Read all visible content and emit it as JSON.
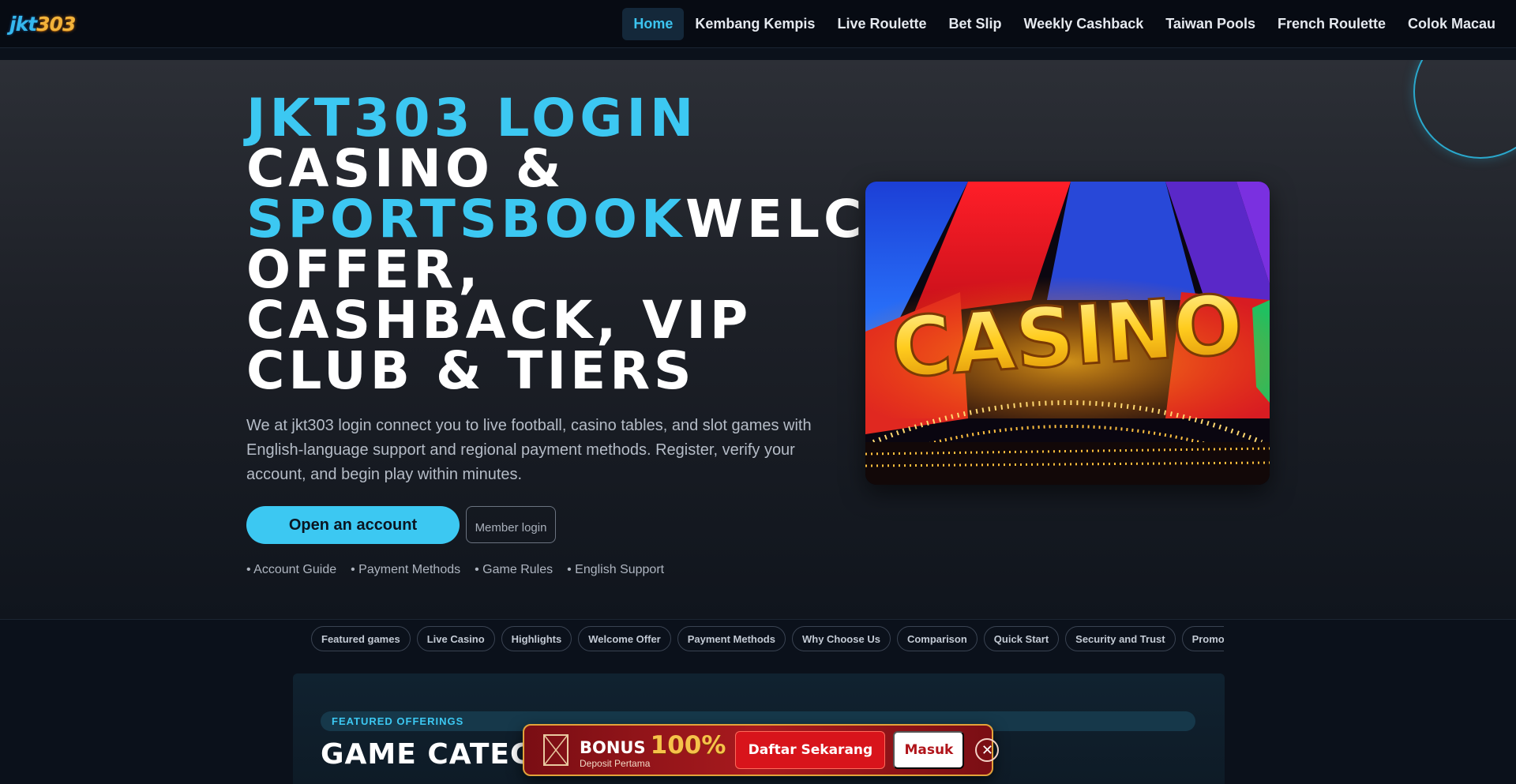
{
  "brand": {
    "logo_part1": "jkt",
    "logo_part2": "303"
  },
  "nav": {
    "items": [
      {
        "label": "Home",
        "active": true
      },
      {
        "label": "Kembang Kempis"
      },
      {
        "label": "Live Roulette"
      },
      {
        "label": "Bet Slip"
      },
      {
        "label": "Weekly Cashback"
      },
      {
        "label": "Taiwan Pools"
      },
      {
        "label": "French Roulette"
      },
      {
        "label": "Colok Macau"
      }
    ]
  },
  "hero": {
    "title_line1": "JKT303 LOGIN",
    "title_line2": "CASINO &",
    "title_line3_accent": "SPORTSBOOK",
    "title_line3_rest": "WELCOME",
    "title_line4": "OFFER,",
    "title_line5": "CASHBACK, VIP",
    "title_line6": "CLUB & TIERS",
    "description": "We at jkt303 login connect you to live football, casino tables, and slot games with English-language support and regional payment methods. Register, verify your account, and begin play within minutes.",
    "primary_cta": "Open an account",
    "secondary_cta": "Member login",
    "quick_links": [
      "Account Guide",
      "Payment Methods",
      "Game Rules",
      "English Support"
    ],
    "image_text": "CASINO"
  },
  "chips": [
    "Featured games",
    "Live Casino",
    "Highlights",
    "Welcome Offer",
    "Payment Methods",
    "Why Choose Us",
    "Comparison",
    "Quick Start",
    "Security and Trust",
    "Promotions"
  ],
  "featured": {
    "eyebrow": "FEATURED OFFERINGS",
    "title": "GAME CATEGORIES"
  },
  "promo": {
    "bonus_label": "BONUS",
    "bonus_percent": "100%",
    "subtitle": "Deposit Pertama",
    "register_button": "Daftar Sekarang",
    "login_button": "Masuk",
    "close_symbol": "✕"
  },
  "colors": {
    "accent": "#3cc8f2",
    "background": "#0b111b",
    "promo_red": "#a81a1e",
    "promo_gold": "#f6c24a"
  }
}
